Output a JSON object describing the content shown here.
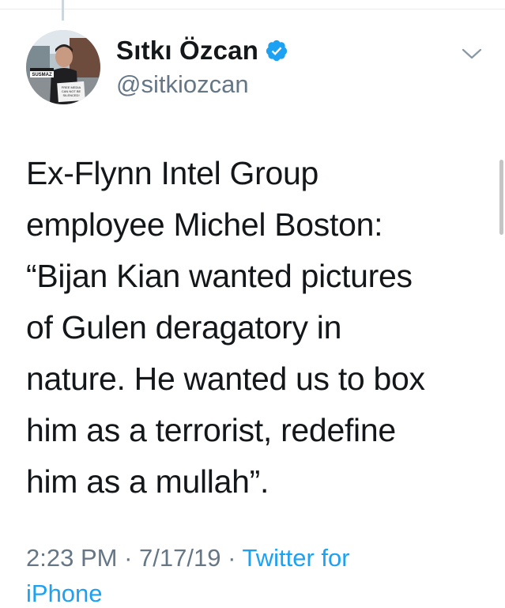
{
  "tweet": {
    "display_name": "Sıtkı Özcan",
    "handle": "@sitkiozcan",
    "text": "Ex-Flynn Intel Group\nemployee Michel Boston:\n“Bijan Kian wanted pictures\nof Gulen deragatory in\nnature. He wanted us to box\nhim as a terrorist, redefine\nhim as a mullah”.",
    "time": "2:23 PM",
    "separator": "·",
    "date": "7/17/19",
    "source": "Twitter for",
    "source_cont": "iPhone"
  },
  "avatar": {
    "sign_top": "ÖZGÜR BASIN SUSMAZ",
    "sign_bottom": "FREE MEDIA CAN NOT BE SILENCED!"
  },
  "colors": {
    "text": "#14171a",
    "secondary": "#657786",
    "accent": "#1da1f2",
    "divider": "#e6ecf0"
  },
  "icons": {
    "verified": "verified-badge-icon",
    "caret": "chevron-down-icon"
  }
}
